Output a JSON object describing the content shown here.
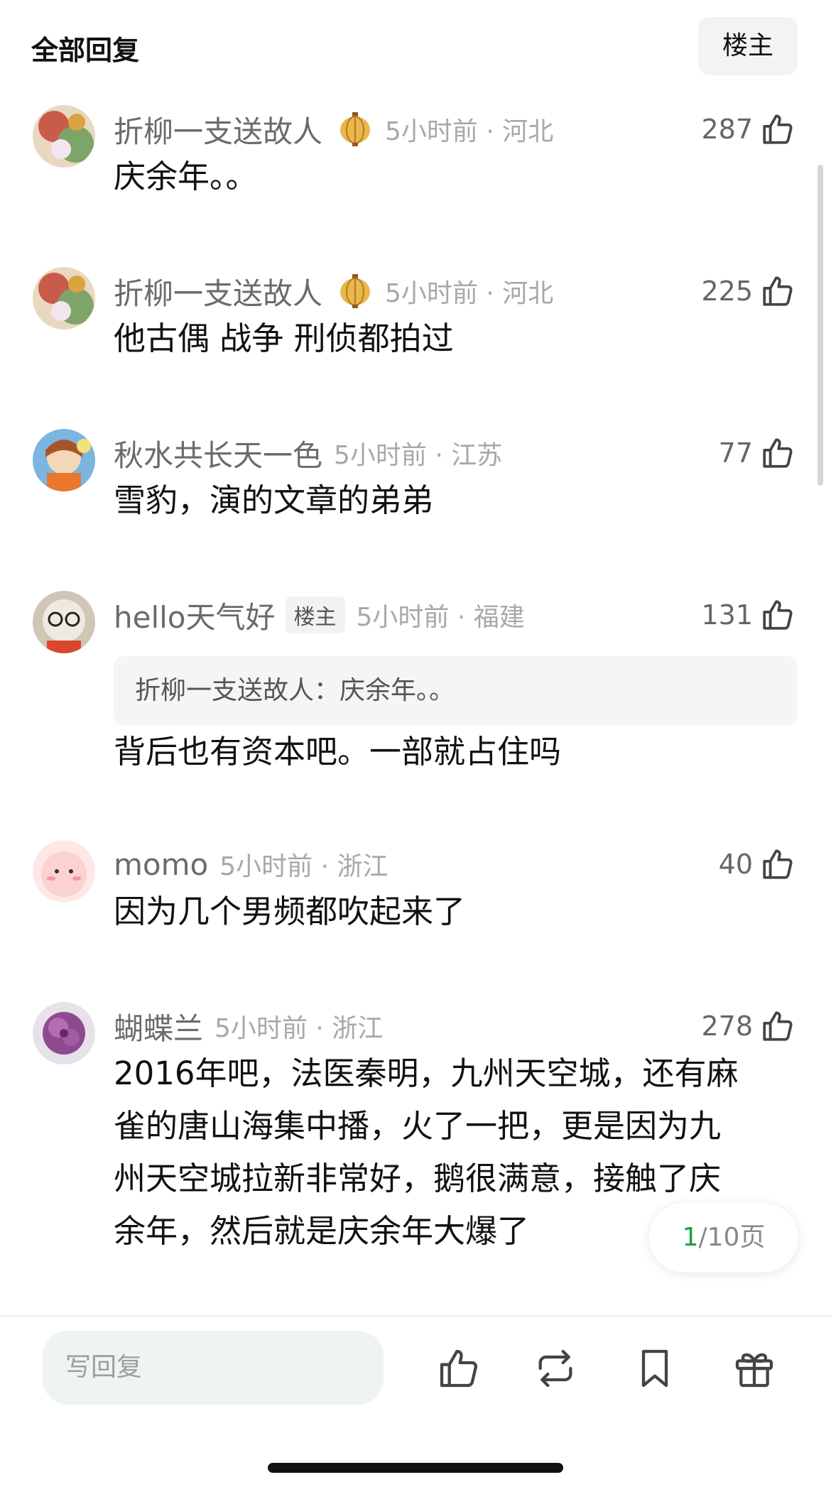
{
  "header": {
    "title": "全部回复",
    "op_button": "楼主"
  },
  "comments": [
    {
      "username": "折柳一支送故人",
      "time": "5小时前 · 河北",
      "likes": "287",
      "text": "庆余年。。"
    },
    {
      "username": "折柳一支送故人",
      "time": "5小时前 · 河北",
      "likes": "225",
      "text": "他古偶 战争 刑侦都拍过"
    },
    {
      "username": "秋水共长天一色",
      "time": "5小时前 · 江苏",
      "likes": "77",
      "text": "雪豹，演的文章的弟弟"
    },
    {
      "username": "hello天气好",
      "op_badge": "楼主",
      "time": "5小时前 · 福建",
      "likes": "131",
      "quote": "折柳一支送故人：庆余年。。",
      "text": "背后也有资本吧。一部就占住吗"
    },
    {
      "username": "momo",
      "time": "5小时前 · 浙江",
      "likes": "40",
      "text": "因为几个男频都吹起来了"
    },
    {
      "username": "蝴蝶兰",
      "time": "5小时前 · 浙江",
      "likes": "278",
      "text_lines": [
        "2016年吧，法医秦明，九州天空城，还有麻",
        "雀的唐山海集中播，火了一把，更是因为九",
        "州天空城拉新非常好，鹅很满意，接触了庆",
        "余年，然后就是庆余年大爆了"
      ]
    }
  ],
  "pagination": {
    "current": "1",
    "total_text": "/10页"
  },
  "bottom_bar": {
    "reply_placeholder": "写回复"
  },
  "colors": {
    "accent_green": "#1f9f4a",
    "meta_gray": "#a8a8a8"
  },
  "icons": [
    "thumbs-up-icon",
    "lantern-badge-icon",
    "repost-icon",
    "bookmark-icon",
    "gift-icon"
  ]
}
